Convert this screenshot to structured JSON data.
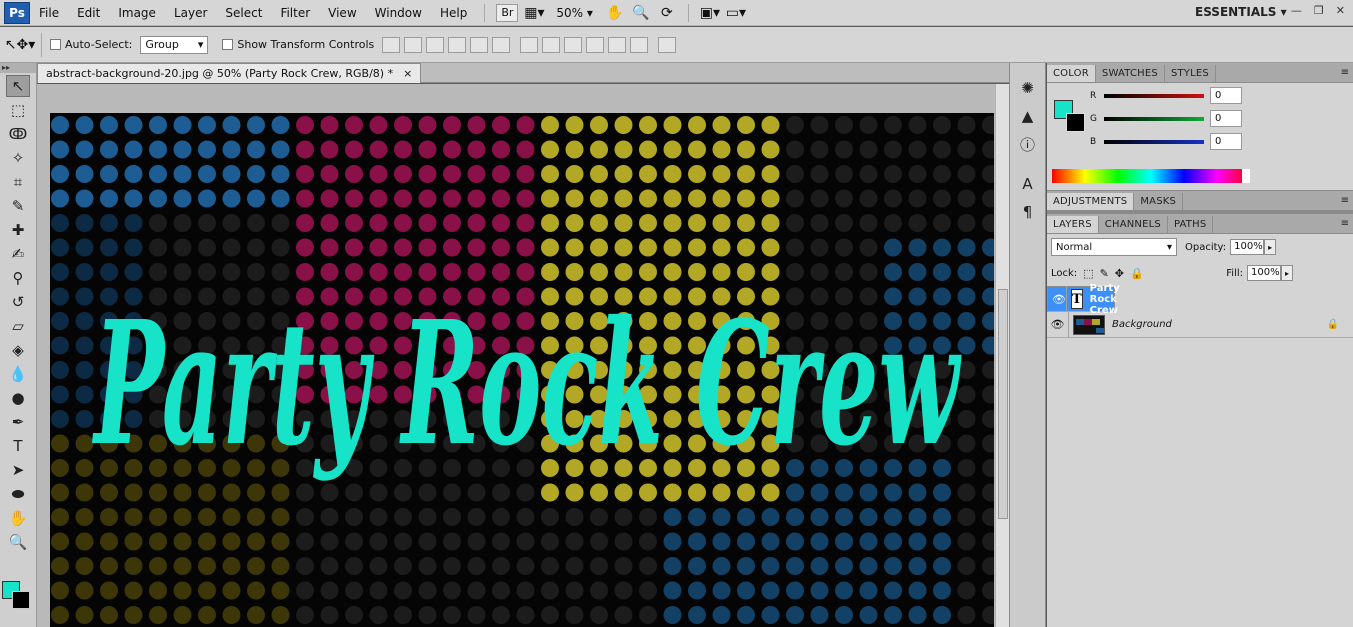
{
  "menubar": {
    "logo": "Ps",
    "items": [
      "File",
      "Edit",
      "Image",
      "Layer",
      "Select",
      "Filter",
      "View",
      "Window",
      "Help"
    ],
    "bridge_label": "Br",
    "zoom": "50%",
    "workspace": "ESSENTIALS"
  },
  "options": {
    "auto_select_label": "Auto-Select:",
    "auto_select_value": "Group",
    "transform_label": "Show Transform Controls"
  },
  "document": {
    "tab_title": "abstract-background-20.jpg @ 50% (Party Rock Crew, RGB/8) *",
    "close": "×",
    "canvas_text": "Party Rock Crew",
    "text_color": "#17e3c8"
  },
  "color_panel": {
    "tabs": [
      "COLOR",
      "SWATCHES",
      "STYLES"
    ],
    "foreground": "#17e3c8",
    "background": "#000000",
    "channels": [
      {
        "label": "R",
        "value": "0",
        "color": "#d01010"
      },
      {
        "label": "G",
        "value": "0",
        "color": "#13a83a"
      },
      {
        "label": "B",
        "value": "0",
        "color": "#1732c9"
      }
    ]
  },
  "adjust_panel": {
    "tabs": [
      "ADJUSTMENTS",
      "MASKS"
    ]
  },
  "layers_panel": {
    "tabs": [
      "LAYERS",
      "CHANNELS",
      "PATHS"
    ],
    "blend_mode": "Normal",
    "opacity_label": "Opacity:",
    "opacity": "100%",
    "lock_label": "Lock:",
    "fill_label": "Fill:",
    "fill": "100%",
    "layers": [
      {
        "name": "Party Rock Crew",
        "thumb": "T",
        "selected": true
      },
      {
        "name": "Background",
        "selected": false
      }
    ]
  }
}
